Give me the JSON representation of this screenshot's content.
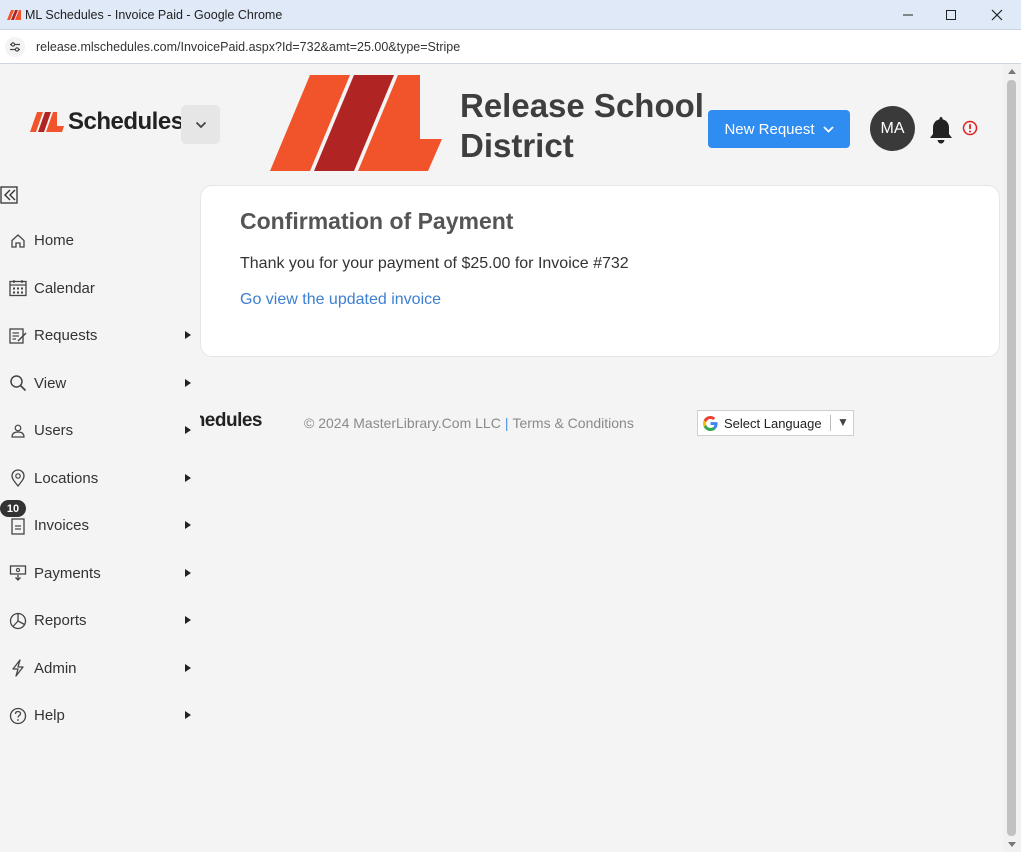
{
  "browser": {
    "window_title": "ML Schedules - Invoice Paid - Google Chrome",
    "url": "release.mlschedules.com/InvoicePaid.aspx?Id=732&amt=25.00&type=Stripe"
  },
  "header": {
    "brand": "Schedules",
    "district_name": "Release School District",
    "new_request_label": "New Request",
    "avatar_initials": "MA"
  },
  "sidebar": {
    "items": [
      {
        "label": "Home",
        "icon": "home-icon",
        "has_submenu": false
      },
      {
        "label": "Calendar",
        "icon": "calendar-icon",
        "has_submenu": false
      },
      {
        "label": "Requests",
        "icon": "requests-icon",
        "has_submenu": true
      },
      {
        "label": "View",
        "icon": "search-icon",
        "has_submenu": true
      },
      {
        "label": "Users",
        "icon": "users-icon",
        "has_submenu": true
      },
      {
        "label": "Locations",
        "icon": "location-pin-icon",
        "has_submenu": true
      },
      {
        "label": "Invoices",
        "icon": "invoice-icon",
        "has_submenu": true,
        "badge": "10"
      },
      {
        "label": "Payments",
        "icon": "payments-icon",
        "has_submenu": true
      },
      {
        "label": "Reports",
        "icon": "pie-chart-icon",
        "has_submenu": true
      },
      {
        "label": "Admin",
        "icon": "lightning-icon",
        "has_submenu": true
      },
      {
        "label": "Help",
        "icon": "help-icon",
        "has_submenu": true
      }
    ]
  },
  "main": {
    "heading": "Confirmation of Payment",
    "message": "Thank you for your payment of $25.00 for Invoice #732",
    "link_text": "Go view the updated invoice"
  },
  "footer": {
    "brand_fragment": "hedules",
    "copyright": "© 2024 MasterLibrary.Com LLC",
    "separator": "|",
    "terms": "Terms & Conditions",
    "language_label": "Select Language"
  },
  "colors": {
    "brand_orange": "#f1542a",
    "brand_dark_red": "#b02423",
    "primary_blue": "#2f8cf0",
    "link_blue": "#3d7fd1",
    "alert_red": "#e02020"
  }
}
